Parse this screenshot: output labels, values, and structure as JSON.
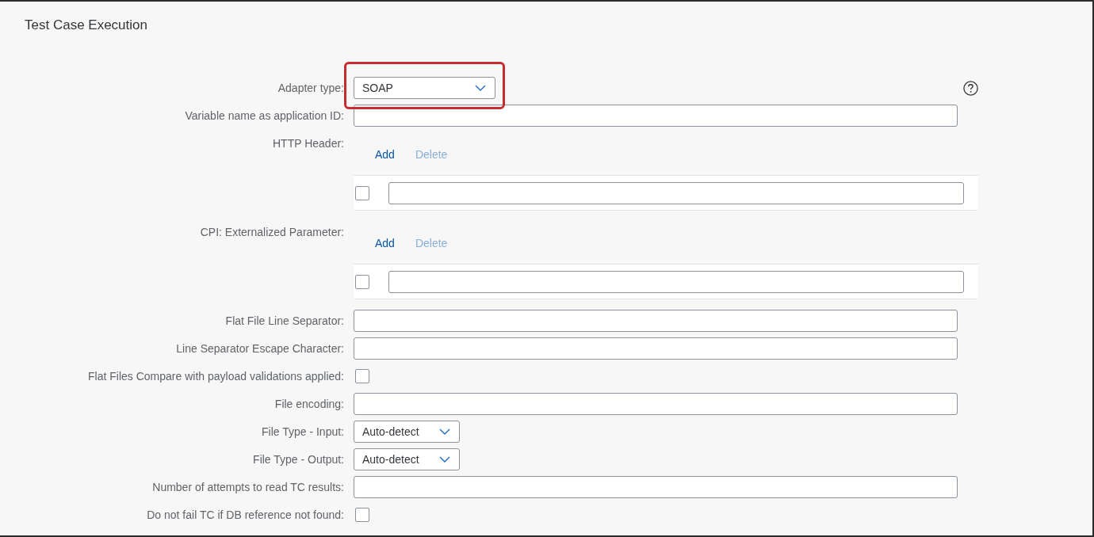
{
  "panel": {
    "title": "Test Case Execution"
  },
  "adapter_type": {
    "label": "Adapter type:",
    "value": "SOAP",
    "highlighted": true
  },
  "fields": [
    {
      "kind": "text",
      "label": "Variable name as application ID:"
    },
    {
      "kind": "table",
      "label": "HTTP Header:",
      "actions": [
        {
          "label": "Add",
          "disabled": false
        },
        {
          "label": "Delete",
          "disabled": true
        }
      ],
      "rows": [
        {
          "checked": false
        }
      ]
    },
    {
      "kind": "table",
      "label": "CPI: Externalized Parameter:",
      "actions": [
        {
          "label": "Add",
          "disabled": false
        },
        {
          "label": "Delete",
          "disabled": true
        }
      ],
      "rows": [
        {
          "checked": false
        }
      ]
    },
    {
      "kind": "text",
      "label": "Flat File Line Separator:"
    },
    {
      "kind": "text",
      "label": "Line Separator Escape Character:"
    },
    {
      "kind": "checkbox",
      "label": "Flat Files Compare with payload validations applied:",
      "checked": false
    },
    {
      "kind": "text",
      "label": "File encoding:"
    },
    {
      "kind": "select",
      "label": "File Type - Input:",
      "value": "Auto-detect"
    },
    {
      "kind": "select",
      "label": "File Type - Output:",
      "value": "Auto-detect"
    },
    {
      "kind": "text",
      "label": "Number of attempts to read TC results:"
    },
    {
      "kind": "checkbox",
      "label": "Do not fail TC if DB reference not found:",
      "checked": false
    }
  ]
}
